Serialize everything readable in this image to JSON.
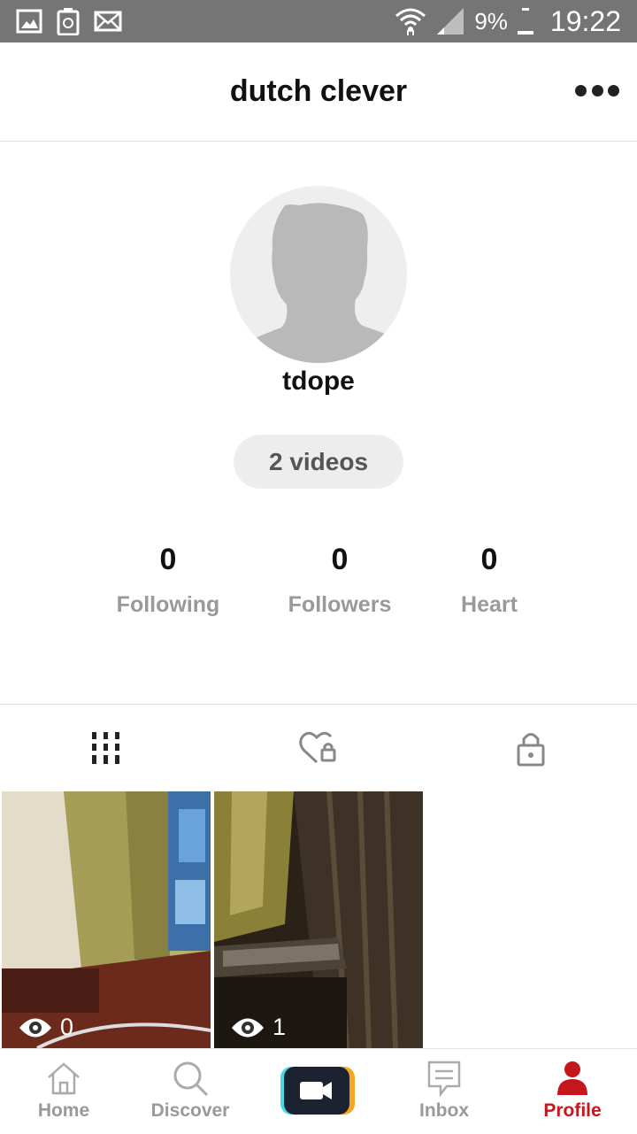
{
  "status_bar": {
    "icons": [
      "gallery-icon",
      "recycle-notification-icon",
      "mail-icon",
      "wifi-icon",
      "signal-icon",
      "battery-icon"
    ],
    "battery": "9%",
    "time": "19:22"
  },
  "header": {
    "title": "dutch clever",
    "more_icon": "more-dots-icon"
  },
  "profile": {
    "username": "tdope",
    "videos_label": "2 videos",
    "stats": [
      {
        "value": "0",
        "label": "Following"
      },
      {
        "value": "0",
        "label": "Followers"
      },
      {
        "value": "0",
        "label": "Heart"
      }
    ]
  },
  "tabs": [
    {
      "icon": "grid-icon",
      "active": true
    },
    {
      "icon": "heart-lock-icon",
      "active": false
    },
    {
      "icon": "lock-icon",
      "active": false
    }
  ],
  "videos": [
    {
      "views": "0"
    },
    {
      "views": "1"
    }
  ],
  "nav": {
    "items": [
      {
        "label": "Home",
        "icon": "home-icon"
      },
      {
        "label": "Discover",
        "icon": "search-icon"
      },
      {
        "label": "",
        "icon": "video-camera-icon"
      },
      {
        "label": "Inbox",
        "icon": "inbox-icon"
      },
      {
        "label": "Profile",
        "icon": "profile-icon"
      }
    ],
    "active_color": "#c4161c"
  }
}
